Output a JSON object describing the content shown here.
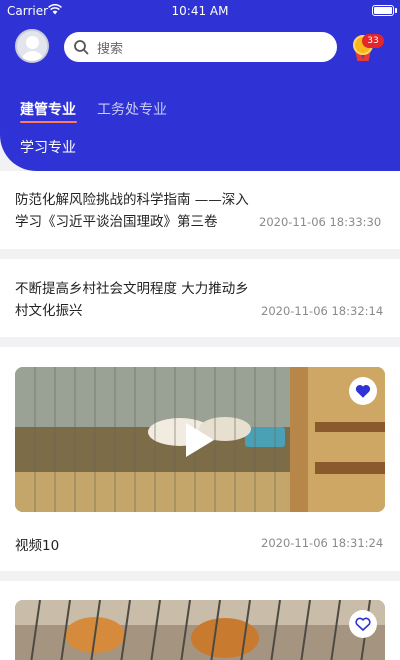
{
  "status_bar": {
    "carrier": "Carrier",
    "time": "10:41 AM"
  },
  "header": {
    "search_placeholder": "搜索",
    "medal_count": "33",
    "accent_color": "#2f33d6",
    "tabs": [
      {
        "label": "建管专业",
        "selected": true
      },
      {
        "label": "工务处专业",
        "selected": false
      },
      {
        "label": "学习专业",
        "selected": false
      }
    ]
  },
  "feed": {
    "articles": [
      {
        "title": "防范化解风险挑战的科学指南 ——深入学习《习近平谈治国理政》第三卷",
        "time": "2020-11-06 18:33:30"
      },
      {
        "title": "不断提高乡村社会文明程度 大力推动乡村文化振兴",
        "time": "2020-11-06 18:32:14"
      }
    ],
    "videos": [
      {
        "title": "视频10",
        "time": "2020-11-06 18:31:24",
        "favorited": true
      }
    ],
    "partial_video": {
      "favorited": false
    }
  }
}
